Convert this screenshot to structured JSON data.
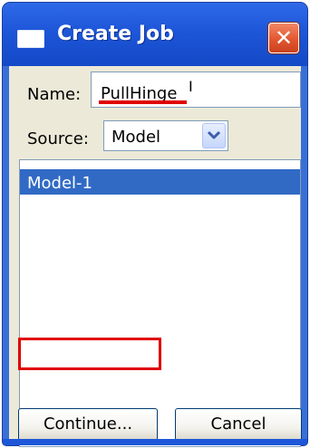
{
  "window": {
    "title": "Create Job",
    "close_symbol": "✕"
  },
  "form": {
    "name_label": "Name:",
    "name_value": "PullHinge",
    "source_label": "Source:",
    "source_value": "Model"
  },
  "model_list": {
    "items": [
      {
        "label": "Model-1",
        "selected": true
      }
    ]
  },
  "buttons": {
    "continue": "Continue...",
    "cancel": "Cancel"
  },
  "colors": {
    "title_bar": "#1d56d8",
    "selection": "#316ac5",
    "annotation": "#e00000",
    "close_button": "#e2572f"
  },
  "icons": {
    "title": "window-app-icon",
    "close": "close-icon",
    "dropdown": "chevron-down-icon",
    "cursor": "text-cursor-icon"
  }
}
